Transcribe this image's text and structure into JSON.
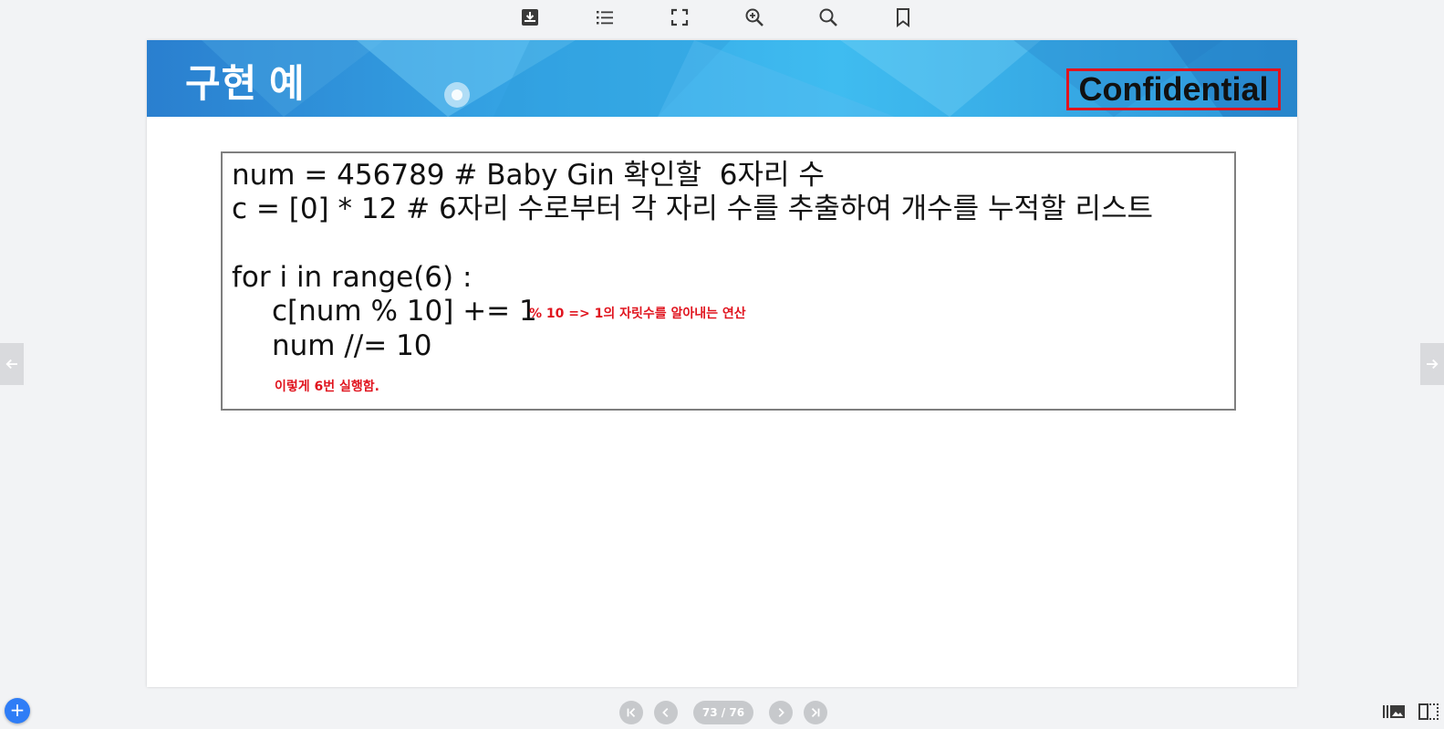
{
  "toolbar": {
    "icons": [
      "download-icon",
      "list-icon",
      "fullscreen-icon",
      "zoom-in-icon",
      "search-icon",
      "bookmark-icon"
    ]
  },
  "slide": {
    "title": "구현 예",
    "badge": "Confidential",
    "code": {
      "line1": "num = 456789 # Baby Gin 확인할  6자리 수",
      "line2": "c = [0] * 12 # 6자리 수로부터 각 자리 수를 추출하여 개수를 누적할 리스트",
      "line3": "for i in range(6) :",
      "line4": "c[num % 10] += 1",
      "line5": "num //= 10"
    },
    "annotations": {
      "mod_note": "% 10 => 1의 자릿수를 알아내는 연산",
      "loop_note": "이렇게 6번 실행함."
    }
  },
  "pagination": {
    "indicator": "73 / 76"
  },
  "colors": {
    "accent_red": "#e0141e",
    "banner_blue": "#35a7e6",
    "add_button": "#2f7df6"
  }
}
